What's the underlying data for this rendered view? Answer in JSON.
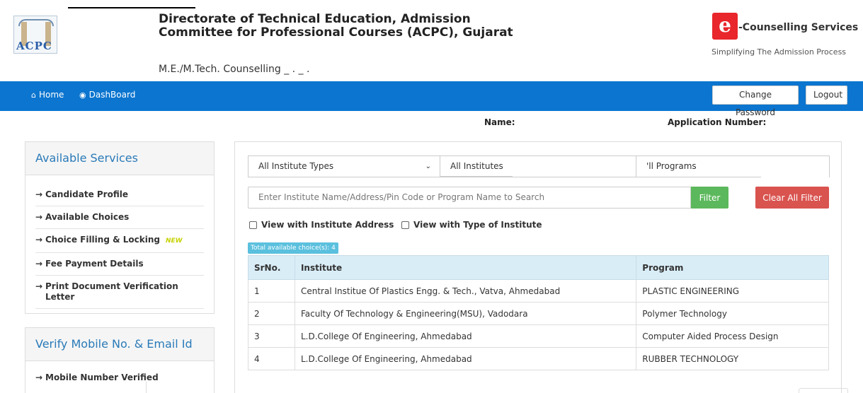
{
  "header": {
    "logo_text": "ACPC",
    "title": "Directorate of Technical Education, Admission Committee for Professional Courses (ACPC), Gujarat",
    "subtitle": "M.E./M.Tech. Counselling _ . _ .",
    "ec_logo_glyph": "e",
    "ec_title": "-Counselling Services",
    "ec_tagline": "Simplifying The Admission Process"
  },
  "nav": {
    "home_label": "Home",
    "dashboard_label": "DashBoard",
    "change_password_label": "Change Password",
    "logout_label": "Logout",
    "home_icon": "home-icon",
    "dashboard_icon": "dashboard-icon",
    "bar_color": "#0b75cf"
  },
  "user": {
    "name_label": "Name:",
    "application_number_label": "Application Number:"
  },
  "services": {
    "heading": "Available Services",
    "items": [
      {
        "label": "Candidate Profile"
      },
      {
        "label": "Available Choices"
      },
      {
        "label": "Choice Filling & Locking",
        "badge": "NEW"
      },
      {
        "label": "Fee Payment Details"
      },
      {
        "label": "Print Document Verification Letter"
      }
    ]
  },
  "verify": {
    "heading": "Verify Mobile No. & Email Id",
    "item": "Mobile Number Verified"
  },
  "filters": {
    "institute_type": "All Institute Types",
    "institutes": "All Institutes",
    "programs": "'ll Programs",
    "search_placeholder": "Enter Institute Name/Address/Pin Code or Program Name to Search",
    "filter_label": "Filter",
    "clear_label": "Clear All Filter",
    "view_address_label": "View with Institute Address",
    "view_type_label": "View with Type of Institute"
  },
  "choices": {
    "total_label": "Total available choice(s): 4",
    "columns": [
      "SrNo.",
      "Institute",
      "Program"
    ],
    "rows": [
      {
        "sr": "1",
        "institute": "Central Institue Of Plastics Engg. & Tech., Vatva, Ahmedabad",
        "program": "PLASTIC ENGINEERING"
      },
      {
        "sr": "2",
        "institute": "Faculty Of Technology & Engineering(MSU), Vadodara",
        "program": "Polymer Technology"
      },
      {
        "sr": "3",
        "institute": "L.D.College Of Engineering, Ahmedabad",
        "program": "Computer Aided Process Design"
      },
      {
        "sr": "4",
        "institute": "L.D.College Of Engineering, Ahmedabad",
        "program": "RUBBER TECHNOLOGY"
      }
    ]
  }
}
